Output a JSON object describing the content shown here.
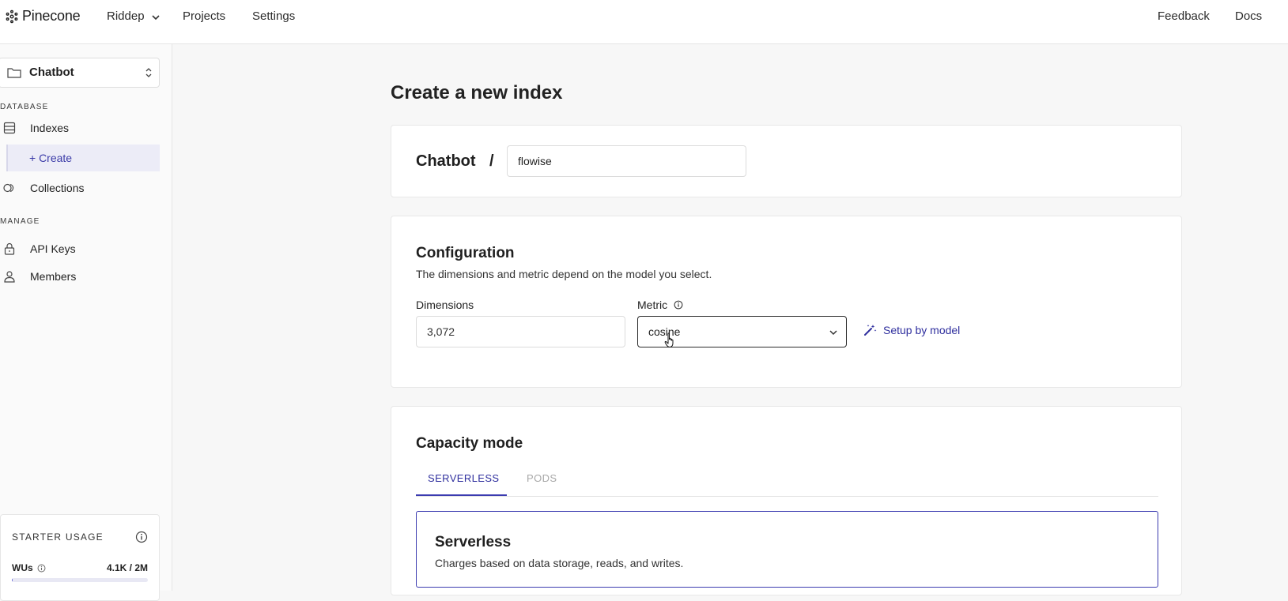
{
  "header": {
    "brand": "Pinecone",
    "org": "Riddep",
    "nav": {
      "projects": "Projects",
      "settings": "Settings",
      "feedback": "Feedback",
      "docs": "Docs"
    }
  },
  "sidebar": {
    "project": "Chatbot",
    "sections": {
      "database": "DATABASE",
      "manage": "MANAGE"
    },
    "items": {
      "indexes": "Indexes",
      "create": "+ Create",
      "collections": "Collections",
      "api_keys": "API Keys",
      "members": "Members"
    },
    "usage": {
      "title": "STARTER USAGE",
      "metric": "WUs",
      "value": "4.1K / 2M",
      "fraction": 0.002
    }
  },
  "main": {
    "title": "Create a new index",
    "index_name": {
      "project": "Chatbot",
      "separator": "/",
      "value": "flowise"
    },
    "configuration": {
      "title": "Configuration",
      "description": "The dimensions and metric depend on the model you select.",
      "dimensions_label": "Dimensions",
      "dimensions_value": "3,072",
      "metric_label": "Metric",
      "metric_value": "cosine",
      "setup_link": "Setup by model"
    },
    "capacity": {
      "title": "Capacity mode",
      "tabs": [
        "SERVERLESS",
        "PODS"
      ],
      "active_tab": "SERVERLESS",
      "serverless_title": "Serverless",
      "serverless_desc": "Charges based on data storage, reads, and writes."
    }
  },
  "colors": {
    "accent": "#3b3bb0",
    "link": "#2f2f9e"
  }
}
